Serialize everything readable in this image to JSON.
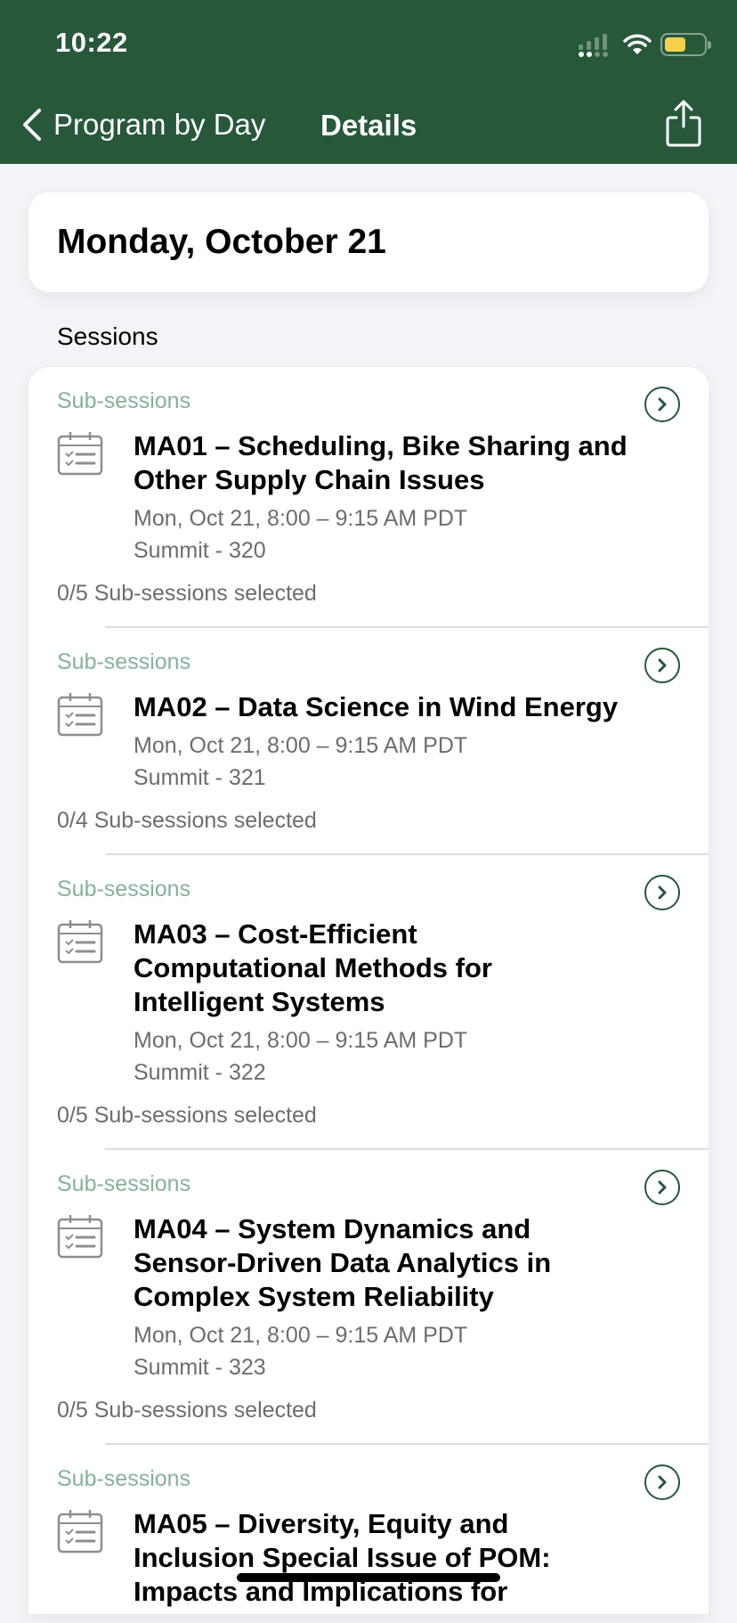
{
  "status_bar": {
    "time": "10:22",
    "icons": [
      "signal-icon",
      "wifi-icon",
      "battery-icon"
    ],
    "battery_level": 0.55
  },
  "nav": {
    "back_label": "Program by Day",
    "title": "Details",
    "share_icon": "share-icon"
  },
  "date_header": "Monday, October 21",
  "section_label": "Sessions",
  "colors": {
    "brand": "#27583a",
    "sub_label": "#86b29a",
    "battery": "#f6d24a",
    "background": "#f3f4f7"
  },
  "sessions": [
    {
      "sub_label": "Sub-sessions",
      "title": "MA01 – Scheduling, Bike Sharing and Other Supply Chain Issues",
      "time": "Mon, Oct 21, 8:00 – 9:15 AM PDT",
      "room": "Summit - 320",
      "selected": "0/5 Sub-sessions selected"
    },
    {
      "sub_label": "Sub-sessions",
      "title": "MA02 – Data Science in Wind Energy",
      "time": "Mon, Oct 21, 8:00 – 9:15 AM PDT",
      "room": "Summit - 321",
      "selected": "0/4 Sub-sessions selected"
    },
    {
      "sub_label": "Sub-sessions",
      "title": "MA03 – Cost-Efficient Computational Methods for Intelligent Systems",
      "time": "Mon, Oct 21, 8:00 – 9:15 AM PDT",
      "room": "Summit - 322",
      "selected": "0/5 Sub-sessions selected"
    },
    {
      "sub_label": "Sub-sessions",
      "title": "MA04 – System Dynamics and Sensor-Driven Data Analytics in Complex System Reliability",
      "time": "Mon, Oct 21, 8:00 – 9:15 AM PDT",
      "room": "Summit - 323",
      "selected": "0/5 Sub-sessions selected"
    },
    {
      "sub_label": "Sub-sessions",
      "title": "MA05 – Diversity, Equity and Inclusion Special Issue of POM: Impacts and Implications for",
      "time": "",
      "room": "",
      "selected": ""
    }
  ]
}
